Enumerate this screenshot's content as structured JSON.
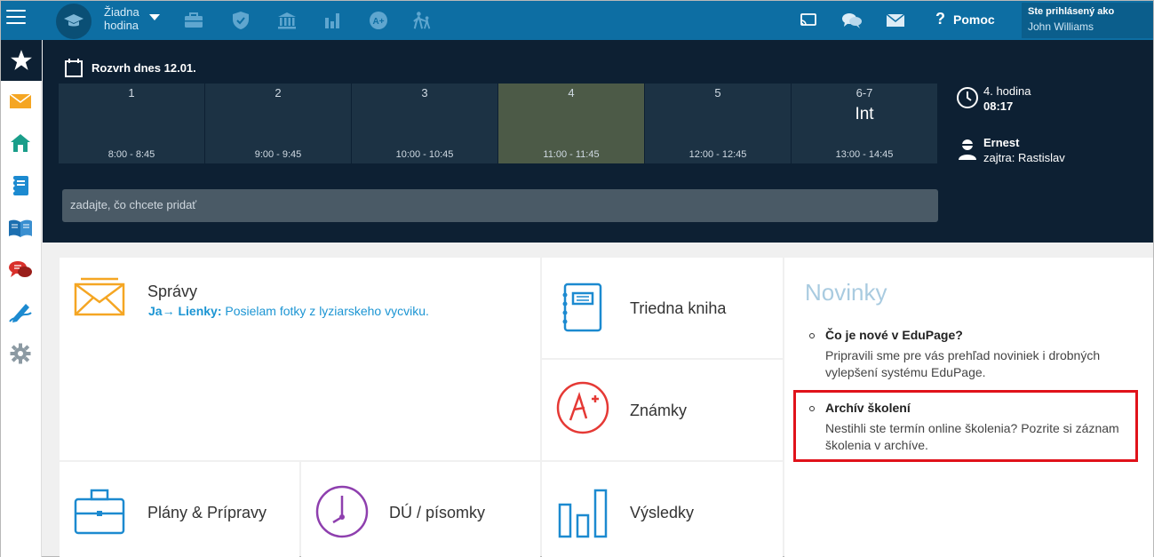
{
  "topbar": {
    "hour_line1": "Žiadna",
    "hour_line2": "hodina",
    "help_label": "Pomoc",
    "user_label": "Ste prihlásený ako",
    "user_name": "John Williams"
  },
  "timetable": {
    "title": "Rozvrh dnes 12.01.",
    "periods": [
      {
        "num": "1",
        "subject": "",
        "time": "8:00 - 8:45"
      },
      {
        "num": "2",
        "subject": "",
        "time": "9:00 - 9:45"
      },
      {
        "num": "3",
        "subject": "",
        "time": "10:00 - 10:45"
      },
      {
        "num": "4",
        "subject": "",
        "time": "11:00 - 11:45"
      },
      {
        "num": "5",
        "subject": "",
        "time": "12:00 - 12:45"
      },
      {
        "num": "6-7",
        "subject": "Int",
        "time": "13:00 - 14:45"
      }
    ],
    "add_placeholder": "zadajte, čo chcete pridať",
    "current_hour": "4. hodina",
    "current_time": "08:17",
    "duty_name": "Ernest",
    "duty_tomorrow": "zajtra: Rastislav"
  },
  "tiles": {
    "messages": {
      "label": "Správy",
      "from": "Ja",
      "arrow": "→",
      "to": "Lienky:",
      "text": "Posielam fotky z lyziarskeho vycviku."
    },
    "classbook": "Triedna kniha",
    "grades": "Známky",
    "plans": "Plány & Prípravy",
    "homework": "DÚ / písomky",
    "results": "Výsledky"
  },
  "news": {
    "title": "Novinky",
    "items": [
      {
        "heading": "Čo je nové v EduPage?",
        "text": "Pripravili sme pre vás prehľad noviniek i drobných vylepšení systému EduPage."
      },
      {
        "heading": "Archív školení",
        "text": "Nestihli ste termín online školenia? Pozrite si záznam školenia v archíve."
      }
    ]
  },
  "colors": {
    "topbar": "#0d6ea3",
    "dark_panel": "#0d2033",
    "active_period": "#4c5a47",
    "link_blue": "#1c95d3",
    "highlight_red": "#e0121a"
  }
}
